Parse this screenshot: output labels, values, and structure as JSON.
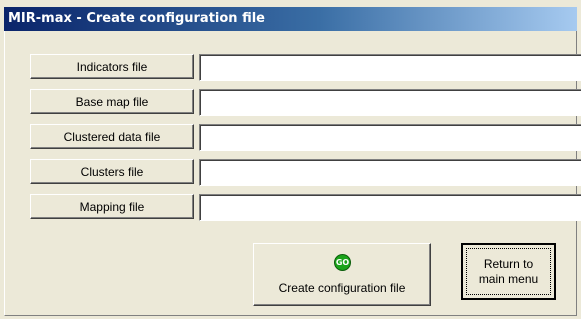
{
  "window": {
    "title": "MIR-max - Create configuration file"
  },
  "files": [
    {
      "label": "Indicators file",
      "value": ""
    },
    {
      "label": "Base map file",
      "value": ""
    },
    {
      "label": "Clustered data file",
      "value": ""
    },
    {
      "label": "Clusters file",
      "value": ""
    },
    {
      "label": "Mapping file",
      "value": ""
    }
  ],
  "actions": {
    "go_icon_text": "GO",
    "create_label": "Create configuration file",
    "return_label": "Return to\nmain menu"
  },
  "colors": {
    "titlebar_start": "#0A246A",
    "titlebar_end": "#A6CAF0",
    "face": "#ECE9D8",
    "go_green": "#1AA31A"
  }
}
